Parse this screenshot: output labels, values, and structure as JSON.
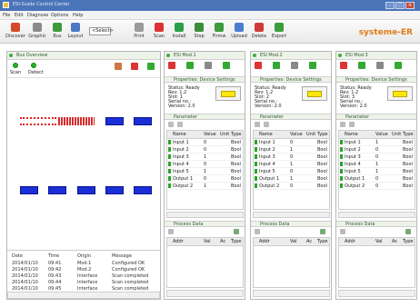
{
  "window": {
    "title": "ESI-Guide Control Center"
  },
  "menu": [
    "File",
    "Edit",
    "Diagnose",
    "Options",
    "Help"
  ],
  "toolbar": {
    "buttons": [
      "Discover",
      "Graphic",
      "Bus",
      "Layout",
      "Print",
      "Scan",
      "Install",
      "Stop",
      "Firmw",
      "Upload",
      "Delete",
      "Export"
    ],
    "select_value": "<Select>",
    "brand": "systeme-ER"
  },
  "left_panel": {
    "header": "Bus Overview",
    "tools": [
      "Scan",
      "Detect"
    ],
    "log": {
      "headers": [
        "Date",
        "Time",
        "Origin",
        "Message"
      ],
      "rows": [
        [
          "2014/01/10",
          "09:41",
          "Mod.1",
          "Configured OK"
        ],
        [
          "2014/01/10",
          "09:42",
          "Mod.2",
          "Configured OK"
        ],
        [
          "2014/01/10",
          "09:43",
          "Interface",
          "Scan completed"
        ],
        [
          "2014/01/10",
          "09:44",
          "Interface",
          "Scan completed"
        ],
        [
          "2014/01/10",
          "09:45",
          "Interface",
          "Scan completed"
        ]
      ]
    }
  },
  "modules": [
    {
      "header": "ESI Mod.1",
      "info_header": "Properties: Device Settings",
      "info_lines": [
        "Status: Ready",
        "Rev: 1.2",
        "Slot: 1",
        "Serial no.:",
        "Version: 2.0"
      ],
      "tbl_header": "Parameter",
      "cols": [
        "Name",
        "Value",
        "Unit",
        "Type"
      ],
      "rows": [
        [
          "Input 1",
          "0",
          "",
          "Bool"
        ],
        [
          "Input 2",
          "0",
          "",
          "Bool"
        ],
        [
          "Input 3",
          "1",
          "",
          "Bool"
        ],
        [
          "Input 4",
          "0",
          "",
          "Bool"
        ],
        [
          "Input 5",
          "1",
          "",
          "Bool"
        ],
        [
          "Output 1",
          "0",
          "",
          "Bool"
        ],
        [
          "Output 2",
          "1",
          "",
          "Bool"
        ]
      ],
      "proc_header": "Process Data",
      "proc_cols": [
        "Addr",
        "Val",
        "Ac",
        "Type"
      ]
    },
    {
      "header": "ESI Mod.2",
      "info_header": "Properties: Device Settings",
      "info_lines": [
        "Status: Ready",
        "Rev: 1.2",
        "Slot: 2",
        "Serial no.:",
        "Version: 2.0"
      ],
      "tbl_header": "Parameter",
      "cols": [
        "Name",
        "Value",
        "Unit",
        "Type"
      ],
      "rows": [
        [
          "Input 1",
          "0",
          "",
          "Bool"
        ],
        [
          "Input 2",
          "1",
          "",
          "Bool"
        ],
        [
          "Input 3",
          "0",
          "",
          "Bool"
        ],
        [
          "Input 4",
          "1",
          "",
          "Bool"
        ],
        [
          "Input 5",
          "0",
          "",
          "Bool"
        ],
        [
          "Output 1",
          "1",
          "",
          "Bool"
        ],
        [
          "Output 2",
          "0",
          "",
          "Bool"
        ]
      ],
      "proc_header": "Process Data",
      "proc_cols": [
        "Addr",
        "Val",
        "Ac",
        "Type"
      ]
    },
    {
      "header": "ESI Mod.3",
      "info_header": "Properties: Device Settings",
      "info_lines": [
        "Status: Ready",
        "Rev: 1.2",
        "Slot: 3",
        "Serial no.:",
        "Version: 2.0"
      ],
      "tbl_header": "Parameter",
      "cols": [
        "Name",
        "Value",
        "Unit",
        "Type"
      ],
      "rows": [
        [
          "Input 1",
          "1",
          "",
          "Bool"
        ],
        [
          "Input 2",
          "0",
          "",
          "Bool"
        ],
        [
          "Input 3",
          "0",
          "",
          "Bool"
        ],
        [
          "Input 4",
          "1",
          "",
          "Bool"
        ],
        [
          "Input 5",
          "1",
          "",
          "Bool"
        ],
        [
          "Output 1",
          "0",
          "",
          "Bool"
        ],
        [
          "Output 2",
          "0",
          "",
          "Bool"
        ]
      ],
      "proc_header": "Process Data",
      "proc_cols": [
        "Addr",
        "Val",
        "Ac",
        "Type"
      ]
    }
  ],
  "colors": {
    "accent_orange": "#e07b1a",
    "device_blue": "#1b2fd8",
    "signal_red": "#e02020",
    "highlight_yellow": "#ffe70a",
    "ok_green": "#27b327"
  }
}
